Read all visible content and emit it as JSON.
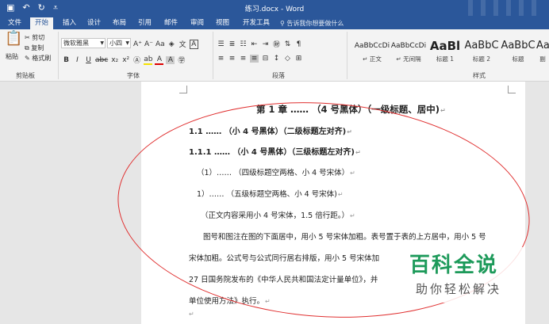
{
  "titlebar": {
    "title": "练习.docx - Word",
    "qat": [
      "save-icon",
      "undo-icon",
      "redo-icon",
      "customize-icon"
    ]
  },
  "tabs": [
    "文件",
    "开始",
    "插入",
    "设计",
    "布局",
    "引用",
    "邮件",
    "审阅",
    "视图",
    "开发工具"
  ],
  "active_tab": "开始",
  "tell_me": "告诉我你想要做什么",
  "ribbon": {
    "clipboard": {
      "paste": "粘贴",
      "cut": "剪切",
      "copy": "复制",
      "format_painter": "格式刷",
      "label": "剪贴板"
    },
    "font": {
      "name": "微软雅黑",
      "size": "小四",
      "label": "字体",
      "grow": "A⁺",
      "shrink": "A⁻",
      "case": "Aa",
      "bold": "B",
      "italic": "I",
      "underline": "U",
      "strike": "abc",
      "subscript": "x₂",
      "superscript": "x²"
    },
    "paragraph": {
      "label": "段落"
    },
    "styles": {
      "label": "样式",
      "items": [
        {
          "sample": "AaBbCcDi",
          "name": "↵ 正文"
        },
        {
          "sample": "AaBbCcDi",
          "name": "↵ 无间隔"
        },
        {
          "sample": "AaBl",
          "name": "标题 1"
        },
        {
          "sample": "AaBbC",
          "name": "标题 2"
        },
        {
          "sample": "AaBbC",
          "name": "标题"
        },
        {
          "sample": "AaBb",
          "name": "副"
        }
      ]
    }
  },
  "document": {
    "lines": [
      "第 1 章 …… （4 号黑体）（一级标题、居中)",
      "1.1 …… （小 4 号黑体）（二级标题左对齐)",
      "1.1.1 …… （小 4 号黑体）（三级标题左对齐)",
      "（1）…… （四级标题空两格、小 4 号宋体）",
      "1）…… （五级标题空两格、小 4 号宋体)",
      "（正文内容采用小 4 号宋体，1.5 倍行距。）",
      "图号和图注在图的下面居中，用小 5 号宋体加粗。表号置于表的上方居中，用小 5 号",
      "宋体加粗。公式号与公式同行居右排版，用小 5 号宋体加",
      "27 日国务院发布的《中华人民共和国法定计量单位》，并",
      "单位使用方法》执行。"
    ],
    "para_mark": "↵"
  },
  "watermark": {
    "title": "百科全说",
    "subtitle": "助你轻松解决"
  }
}
